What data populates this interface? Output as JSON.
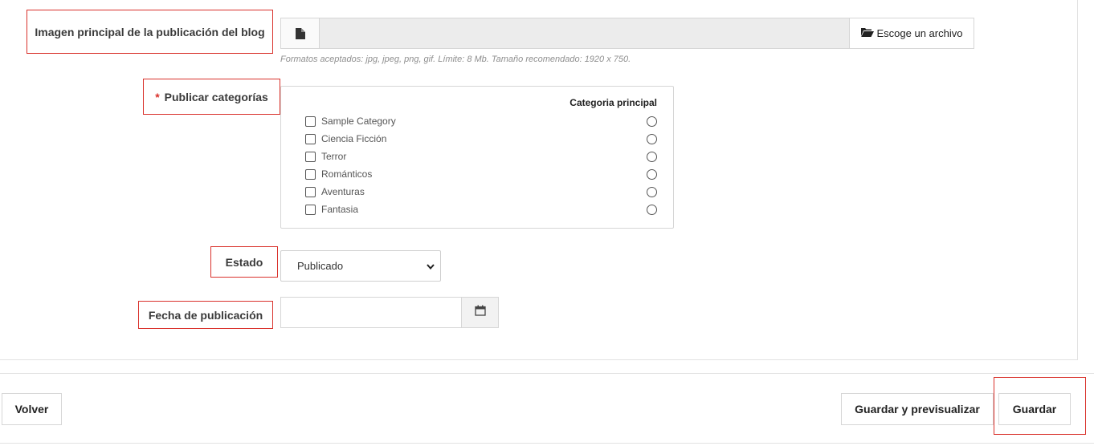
{
  "form": {
    "image_label": "Imagen principal de la publicación del blog",
    "file_button_label": "Escoge un archivo",
    "file_help": "Formatos aceptados: jpg, jpeg, png, gif. Límite: 8 Mb. Tamaño recomendado: 1920 x 750.",
    "categories_required_mark": "*",
    "categories_label": "Publicar categorías",
    "categories_header": "Categoria principal",
    "categories": [
      {
        "label": "Sample Category",
        "checked": false,
        "primary": false
      },
      {
        "label": "Ciencia Ficción",
        "checked": false,
        "primary": false
      },
      {
        "label": "Terror",
        "checked": false,
        "primary": false
      },
      {
        "label": "Románticos",
        "checked": false,
        "primary": false
      },
      {
        "label": "Aventuras",
        "checked": false,
        "primary": false
      },
      {
        "label": "Fantasia",
        "checked": false,
        "primary": false
      }
    ],
    "status_label": "Estado",
    "status_value": "Publicado",
    "date_label": "Fecha de publicación",
    "date_value": ""
  },
  "footer": {
    "back_label": "Volver",
    "save_preview_label": "Guardar y previsualizar",
    "save_label": "Guardar"
  },
  "colors": {
    "highlight": "#d9312b"
  }
}
